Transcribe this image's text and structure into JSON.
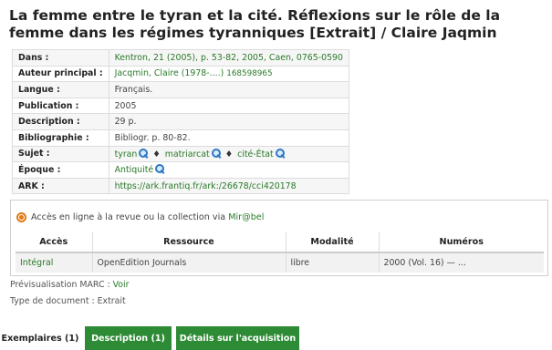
{
  "title": "La femme entre le tyran et la cité. Réflexions sur le rôle de la femme dans les régimes tyranniques [Extrait] / Claire Jaqmin",
  "notice": {
    "dans_label": "Dans :",
    "dans_value": "Kentron, 21 (2005), p. 53-82, 2005, Caen, 0765-0590",
    "auteur_label": "Auteur principal :",
    "auteur_name": "Jacqmin, Claire (1978-....)",
    "auteur_ppn": "168598965",
    "langue_label": "Langue :",
    "langue_value": "Français.",
    "publication_label": "Publication :",
    "publication_value": "2005",
    "description_label": "Description :",
    "description_value": "29 p.",
    "biblio_label": "Bibliographie :",
    "biblio_value": "Bibliogr. p. 80-82.",
    "sujet_label": "Sujet :",
    "sujets": [
      "tyran",
      "matriarcat",
      "cité-État"
    ],
    "separator": "♦",
    "epoque_label": "Époque :",
    "epoque_value": "Antiquité",
    "ark_label": "ARK :",
    "ark_value": "https://ark.frantiq.fr/ark:/26678/cci420178"
  },
  "mirabel": {
    "intro": "Accès en ligne à la revue ou la collection via",
    "link": "Mir@bel",
    "headers": [
      "Accès",
      "Ressource",
      "Modalité",
      "Numéros"
    ],
    "row": [
      "Intégral",
      "OpenEdition Journals",
      "libre",
      "2000 (Vol. 16) — ..."
    ]
  },
  "marc_label": "Prévisualisation MARC :",
  "marc_link": "Voir",
  "doctype": "Type de document : Extrait",
  "tabs": [
    "Exemplaires (1)",
    "Description (1)",
    "Détails sur l'acquisition"
  ],
  "colors": {
    "green": "#2e8b35",
    "link": "#2a7a2a",
    "magnifier": "#2f78c4",
    "mirabel": "#e07a14"
  }
}
